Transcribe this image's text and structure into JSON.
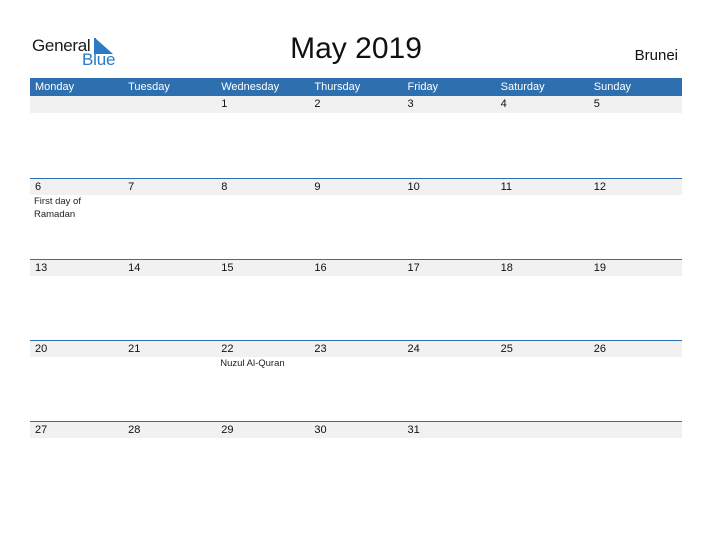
{
  "logo": {
    "general": "General",
    "blue": "Blue"
  },
  "header": {
    "title": "May 2019",
    "country": "Brunei"
  },
  "colors": {
    "accent": "#2e6fb0",
    "date_row_bg": "#f1f1f1",
    "logo_blue": "#2a7bc4"
  },
  "weekdays": [
    "Monday",
    "Tuesday",
    "Wednesday",
    "Thursday",
    "Friday",
    "Saturday",
    "Sunday"
  ],
  "weeks": [
    {
      "days": [
        "",
        "",
        "1",
        "2",
        "3",
        "4",
        "5"
      ],
      "events": [
        "",
        "",
        "",
        "",
        "",
        "",
        ""
      ]
    },
    {
      "days": [
        "6",
        "7",
        "8",
        "9",
        "10",
        "11",
        "12"
      ],
      "events": [
        "First day of Ramadan",
        "",
        "",
        "",
        "",
        "",
        ""
      ]
    },
    {
      "days": [
        "13",
        "14",
        "15",
        "16",
        "17",
        "18",
        "19"
      ],
      "events": [
        "",
        "",
        "",
        "",
        "",
        "",
        ""
      ]
    },
    {
      "days": [
        "20",
        "21",
        "22",
        "23",
        "24",
        "25",
        "26"
      ],
      "events": [
        "",
        "",
        "Nuzul Al-Quran",
        "",
        "",
        "",
        ""
      ]
    },
    {
      "days": [
        "27",
        "28",
        "29",
        "30",
        "31",
        "",
        ""
      ],
      "events": [
        "",
        "",
        "",
        "",
        "",
        "",
        ""
      ]
    }
  ]
}
